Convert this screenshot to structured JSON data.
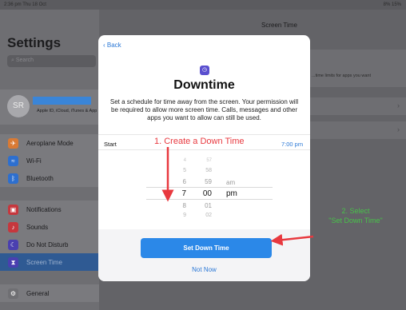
{
  "status": {
    "time": "2:36 pm  Thu 18 Oct",
    "battery": "8% 15%"
  },
  "sidebar": {
    "title": "Settings",
    "search_placeholder": "Search",
    "profile": {
      "initials": "SR",
      "subtitle": "Apple ID, iCloud, iTunes & App St"
    },
    "items": [
      {
        "label": "Aeroplane Mode",
        "icon": "airplane-icon",
        "color": "#d97a34"
      },
      {
        "label": "Wi-Fi",
        "icon": "wifi-icon",
        "color": "#2d6fcf"
      },
      {
        "label": "Bluetooth",
        "icon": "bluetooth-icon",
        "color": "#2d6fcf"
      },
      {
        "label": "Notifications",
        "icon": "notifications-icon",
        "color": "#c6373d"
      },
      {
        "label": "Sounds",
        "icon": "sounds-icon",
        "color": "#c6373d"
      },
      {
        "label": "Do Not Disturb",
        "icon": "moon-icon",
        "color": "#4a3fb0"
      },
      {
        "label": "Screen Time",
        "icon": "hourglass-icon",
        "color": "#4a3fb0"
      },
      {
        "label": "General",
        "icon": "gear-icon",
        "color": "#6f6f73",
        "badge": "1"
      }
    ]
  },
  "detail": {
    "nav_title": "Screen Time",
    "hint": "...time limits for apps you want"
  },
  "modal": {
    "back_label": "Back",
    "heading": "Downtime",
    "description": "Set a schedule for time away from the screen. Your permission will be required to allow more screen time. Calls, messages and other apps you want to allow can still be used.",
    "start_label": "Start",
    "start_value": "7:00 pm",
    "picker": {
      "hours": [
        "4",
        "5",
        "6",
        "7",
        "8",
        "9"
      ],
      "minutes": [
        "57",
        "58",
        "59",
        "00",
        "01",
        "02"
      ],
      "ampm": [
        "am",
        "pm"
      ],
      "selected": {
        "hour": "7",
        "minute": "00",
        "ampm": "pm"
      }
    },
    "primary_button": "Set Down Time",
    "secondary_button": "Not Now"
  },
  "annotations": {
    "step1": "1. Create a Down Time",
    "step2_line1": "2. Select",
    "step2_line2": "\"Set Down Time\"",
    "colors": {
      "step1": "#e8393f",
      "step2": "#48c24a"
    }
  }
}
